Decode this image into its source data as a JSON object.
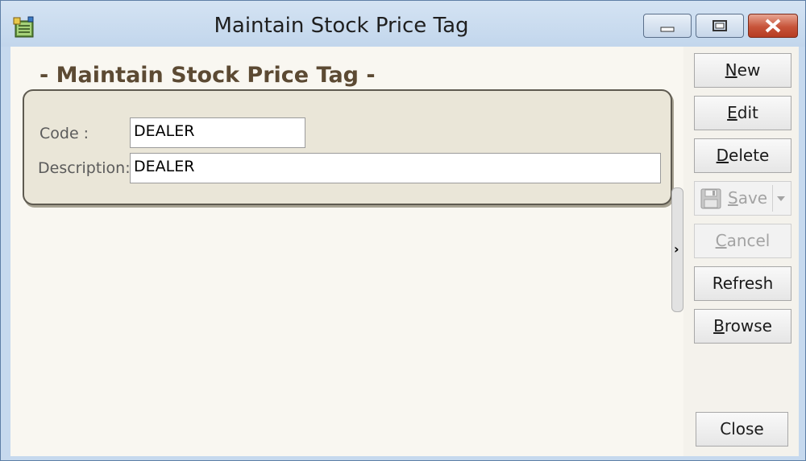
{
  "window": {
    "title": "Maintain Stock Price Tag"
  },
  "form": {
    "heading": "- Maintain Stock Price Tag -",
    "code_label": "Code :",
    "code_value": "DEALER",
    "description_label": "Description:",
    "description_value": "DEALER"
  },
  "buttons": {
    "new_a": "N",
    "new_b": "ew",
    "edit_a": "E",
    "edit_b": "dit",
    "delete_a": "D",
    "delete_b": "elete",
    "save_a": "S",
    "save_b": "ave",
    "cancel_a": "C",
    "cancel_b": "ancel",
    "refresh": "Refresh",
    "browse_a": "B",
    "browse_b": "rowse",
    "close": "Close"
  },
  "splitter": {
    "arrow": "›"
  },
  "colors": {
    "heading": "#5c4a33",
    "group_background": "#eae6d8",
    "title_bar": "#c6d9ee",
    "close_button": "#c7543a"
  },
  "icons": [
    "app-icon",
    "minimize-icon",
    "maximize-icon",
    "close-icon",
    "floppy-disk-icon",
    "chevron-down-icon",
    "chevron-right-icon"
  ]
}
